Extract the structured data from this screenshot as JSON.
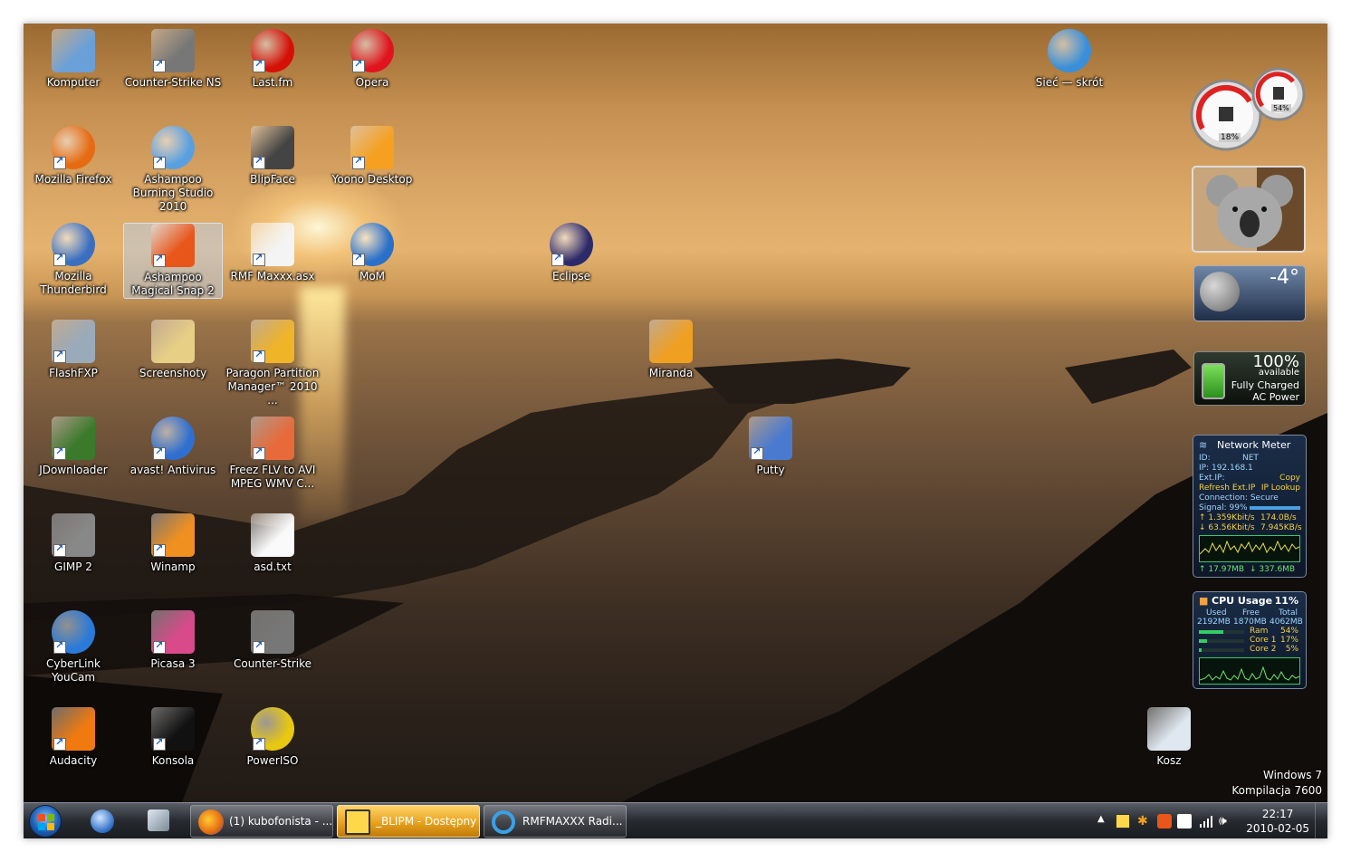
{
  "desktop": {
    "icons": [
      {
        "label": "Komputer",
        "icon": "computer-icon"
      },
      {
        "label": "Counter-Strike NS",
        "icon": "counter-strike-icon"
      },
      {
        "label": "Last.fm",
        "icon": "lastfm-icon"
      },
      {
        "label": "Opera",
        "icon": "opera-icon"
      },
      {
        "label": "Sieć — skrót",
        "icon": "network-icon"
      },
      {
        "label": "Mozilla Firefox",
        "icon": "firefox-icon"
      },
      {
        "label": "Ashampoo Burning Studio 2010",
        "icon": "ashampoo-burning-icon"
      },
      {
        "label": "BlipFace",
        "icon": "blipface-icon"
      },
      {
        "label": "Yoono Desktop",
        "icon": "yoono-icon"
      },
      {
        "label": "Mozilla Thunderbird",
        "icon": "thunderbird-icon"
      },
      {
        "label": "Ashampoo Magical Snap 2",
        "icon": "snap-icon"
      },
      {
        "label": "RMF Maxxx.asx",
        "icon": "media-file-icon"
      },
      {
        "label": "MoM",
        "icon": "mom-icon"
      },
      {
        "label": "Eclipse",
        "icon": "eclipse-icon"
      },
      {
        "label": "FlashFXP",
        "icon": "flashfxp-icon"
      },
      {
        "label": "Screenshoty",
        "icon": "folder-icon"
      },
      {
        "label": "Paragon Partition Manager™ 2010 ...",
        "icon": "paragon-icon"
      },
      {
        "label": "Miranda",
        "icon": "miranda-icon"
      },
      {
        "label": "JDownloader",
        "icon": "jdownloader-icon"
      },
      {
        "label": "avast! Antivirus",
        "icon": "avast-icon"
      },
      {
        "label": "Freez FLV to AVI MPEG WMV C...",
        "icon": "freez-icon"
      },
      {
        "label": "Putty",
        "icon": "putty-icon"
      },
      {
        "label": "GIMP 2",
        "icon": "gimp-icon"
      },
      {
        "label": "Winamp",
        "icon": "winamp-icon"
      },
      {
        "label": "asd.txt",
        "icon": "text-file-icon"
      },
      {
        "label": "CyberLink YouCam",
        "icon": "youcam-icon"
      },
      {
        "label": "Picasa 3",
        "icon": "picasa-icon"
      },
      {
        "label": "Counter-Strike",
        "icon": "counter-strike-icon"
      },
      {
        "label": "Audacity",
        "icon": "audacity-icon"
      },
      {
        "label": "Konsola",
        "icon": "console-icon"
      },
      {
        "label": "PowerISO",
        "icon": "poweriso-icon"
      },
      {
        "label": "Kosz",
        "icon": "recycle-bin-icon"
      }
    ],
    "selected_icon": "Ashampoo Magical Snap 2"
  },
  "gadgets": {
    "meter": {
      "cpu": "18%",
      "ram": "54%"
    },
    "weather": {
      "temp": "-4°"
    },
    "battery": {
      "percent": "100%",
      "available": "available",
      "status": "Fully Charged",
      "power": "AC Power"
    },
    "network": {
      "title": "Network Meter",
      "id": "ID:",
      "id_value": "NET",
      "ip": "IP: 192.168.1",
      "ext_ip": "Ext.IP:",
      "copy": "Copy",
      "refresh": "Refresh Ext.IP",
      "lookup": "IP Lookup",
      "connection": "Connection: Secure",
      "signal": "Signal: 99%",
      "up_rate": "1.359Kbit/s",
      "up_bytes": "174.0B/s",
      "down_rate": "63.56Kbit/s",
      "down_bytes": "7.945KB/s",
      "total_up": "17.97MB",
      "total_down": "337.6MB"
    },
    "cpu": {
      "title": "CPU Usage",
      "percent": "11%",
      "used_label": "Used",
      "free_label": "Free",
      "total_label": "Total",
      "used": "2192MB",
      "free": "1870MB",
      "total": "4062MB",
      "ram_label": "Ram",
      "ram_pct": "54%",
      "core1_label": "Core 1",
      "core1_pct": "17%",
      "core2_label": "Core 2",
      "core2_pct": "5%",
      "ram_level": 0.54,
      "core1_level": 0.17,
      "core2_level": 0.05
    }
  },
  "watermark": {
    "line1": "Windows 7",
    "line2": "Kompilacja 7600"
  },
  "taskbar": {
    "tasks": [
      {
        "label": "(1) kubofonista - ...",
        "icon": "firefox-icon"
      },
      {
        "label": "_BLIPM - Dostępny",
        "icon": "blipm-icon"
      },
      {
        "label": "RMFMAXXX Radi...",
        "icon": "ie-icon"
      }
    ],
    "clock": {
      "time": "22:17",
      "date": "2010-02-05"
    }
  },
  "colors": {
    "taskbar": "#2a2e35",
    "active_task": "#e8a21c",
    "accent": "#1f5fbf"
  }
}
